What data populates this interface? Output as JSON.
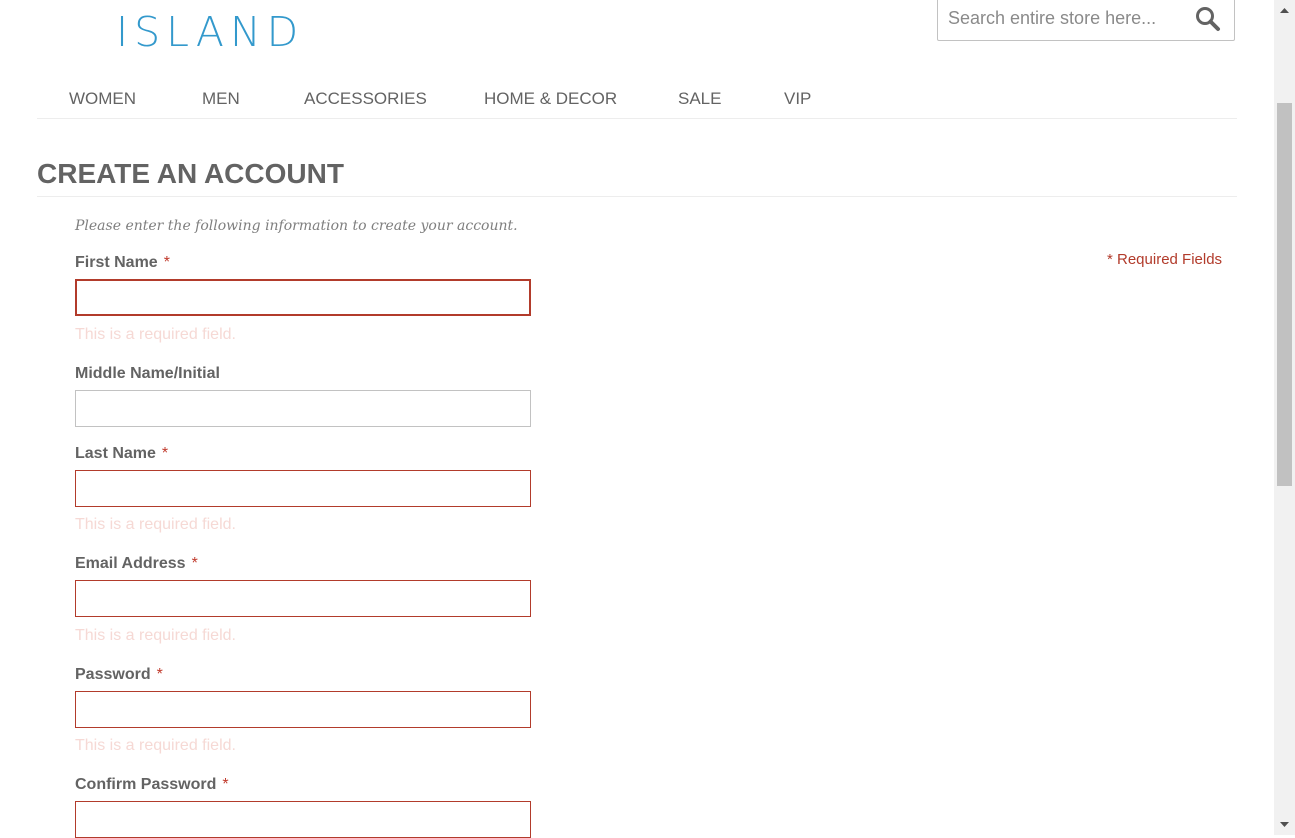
{
  "logo": "ISLAND",
  "search": {
    "placeholder": "Search entire store here..."
  },
  "nav": [
    "WOMEN",
    "MEN",
    "ACCESSORIES",
    "HOME & DECOR",
    "SALE",
    "VIP"
  ],
  "page": {
    "title": "CREATE AN ACCOUNT",
    "intro": "Please enter the following information to create your account.",
    "required_fields": "* Required Fields"
  },
  "form": {
    "fields": [
      {
        "label": "First Name",
        "required": "*",
        "error": "This is a required field."
      },
      {
        "label": "Middle Name/Initial"
      },
      {
        "label": "Last Name",
        "required": "*",
        "error": "This is a required field."
      },
      {
        "label": "Email Address",
        "required": "*",
        "error": "This is a required field."
      },
      {
        "label": "Password",
        "required": "*",
        "error": "This is a required field."
      },
      {
        "label": "Confirm Password",
        "required": "*"
      }
    ]
  },
  "colors": {
    "accent": "#3399cc",
    "error": "#b23b2b",
    "text": "#636363"
  }
}
